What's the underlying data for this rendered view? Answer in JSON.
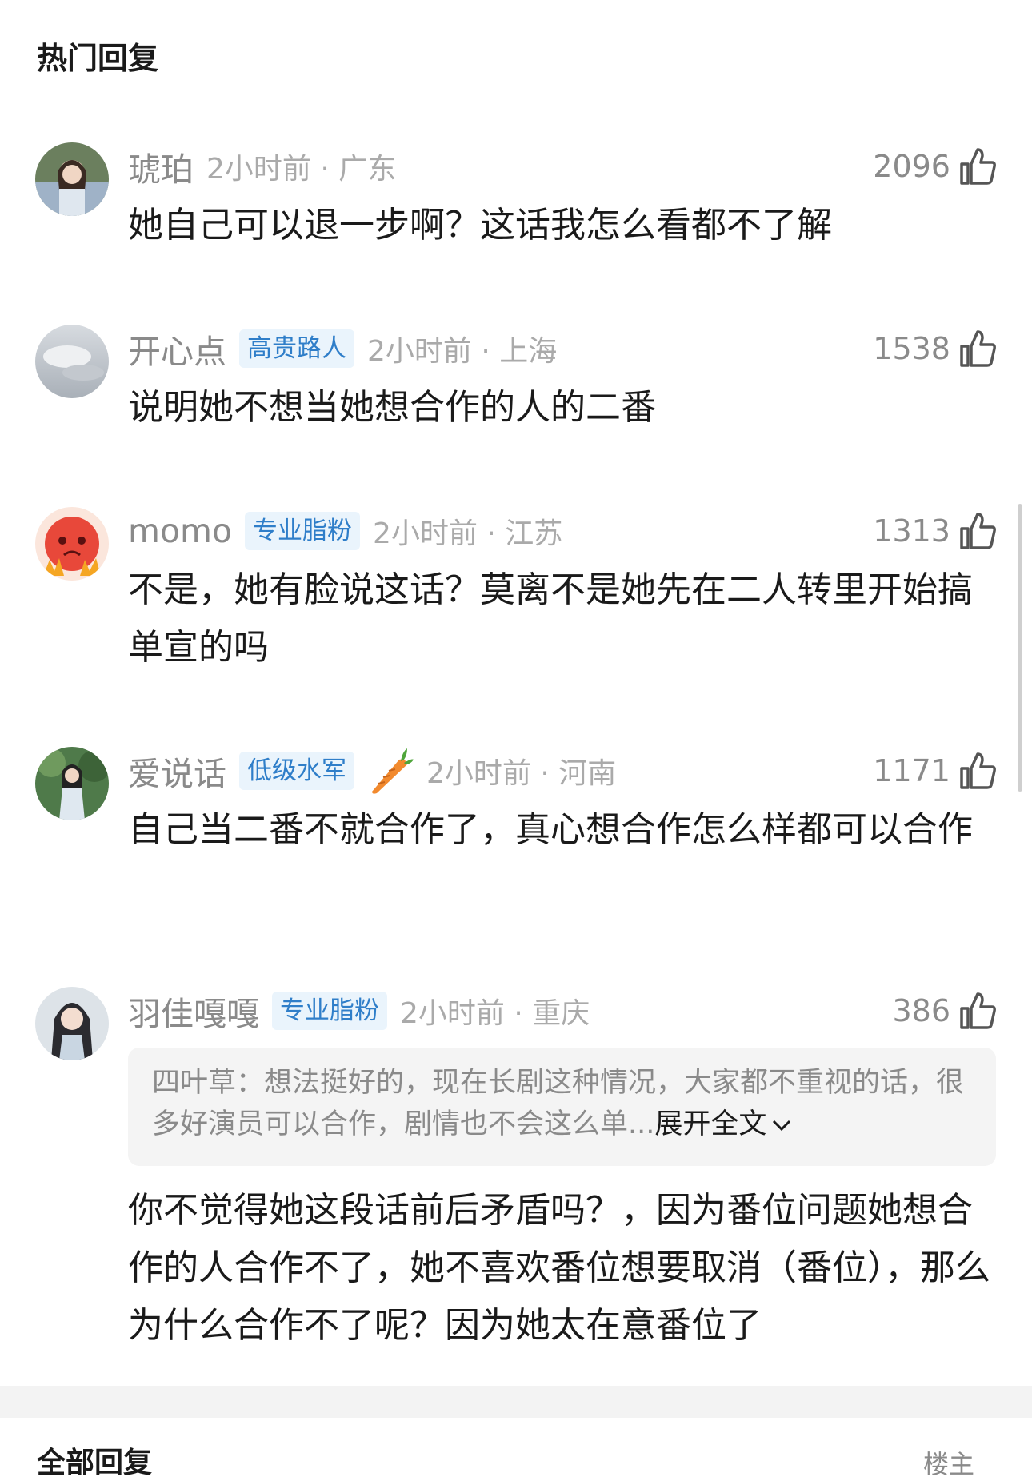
{
  "header": {
    "title": "热门回复"
  },
  "comments": [
    {
      "username": "琥珀",
      "badge": "",
      "time": "2小时前 · 广东",
      "likes": "2096",
      "text": "她自己可以退一步啊？这话我怎么看都不了解"
    },
    {
      "username": "开心点",
      "badge": "高贵路人",
      "time": "2小时前 · 上海",
      "likes": "1538",
      "text": "说明她不想当她想合作的人的二番"
    },
    {
      "username": "momo",
      "badge": "专业脂粉",
      "time": "2小时前 · 江苏",
      "likes": "1313",
      "text": "不是，她有脸说这话？莫离不是她先在二人转里开始搞单宣的吗"
    },
    {
      "username": "爱说话",
      "badge": "低级水军",
      "time": "2小时前 · 河南",
      "likes": "1171",
      "text": "自己当二番不就合作了，真心想合作怎么样都可以合作"
    },
    {
      "username": "羽佳嘎嘎",
      "badge": "专业脂粉",
      "time": "2小时前 · 重庆",
      "likes": "386",
      "quote": "四叶草：想法挺好的，现在长剧这种情况，大家都不重视的话，很多好演员可以合作，剧情也不会这么单...",
      "expand": "展开全文",
      "text": "你不觉得她这段话前后矛盾吗？，因为番位问题她想合作的人合作不了，她不喜欢番位想要取消（番位），那么为什么合作不了呢？因为她太在意番位了"
    }
  ],
  "footer": {
    "title": "全部回复",
    "sort": "楼主"
  }
}
